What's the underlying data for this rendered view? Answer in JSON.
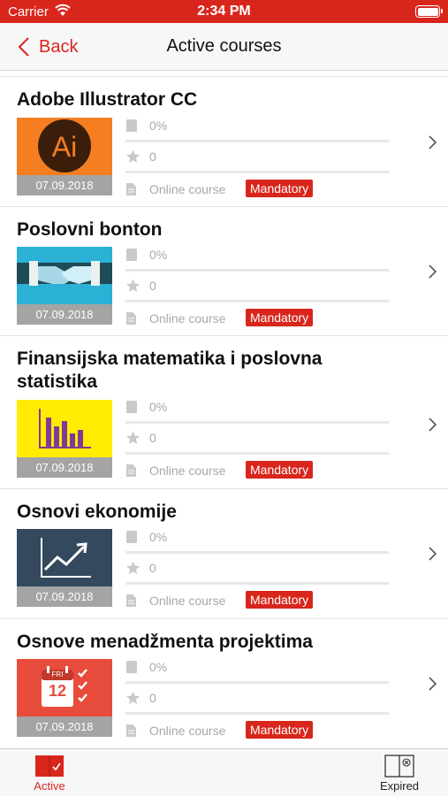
{
  "status_bar": {
    "carrier": "Carrier",
    "time": "2:34 PM"
  },
  "nav": {
    "back_label": "Back",
    "title": "Active courses"
  },
  "courses": [
    {
      "title": "Adobe Illustrator CC",
      "date": "07.09.2018",
      "progress": "0%",
      "rating": "0",
      "type": "Online course",
      "badge": "Mandatory",
      "thumb_icon": "illustrator-logo-icon",
      "thumb_color": "#f47e21"
    },
    {
      "title": "Poslovni bonton",
      "date": "07.09.2018",
      "progress": "0%",
      "rating": "0",
      "type": "Online course",
      "badge": "Mandatory",
      "thumb_icon": "handshake-icon",
      "thumb_color": "#2bb0d6"
    },
    {
      "title": "Finansijska matematika i poslovna statistika",
      "date": "07.09.2018",
      "progress": "0%",
      "rating": "0",
      "type": "Online course",
      "badge": "Mandatory",
      "thumb_icon": "bar-chart-icon",
      "thumb_color": "#ffec00"
    },
    {
      "title": "Osnovi ekonomije",
      "date": "07.09.2018",
      "progress": "0%",
      "rating": "0",
      "type": "Online course",
      "badge": "Mandatory",
      "thumb_icon": "trend-chart-icon",
      "thumb_color": "#34495e"
    },
    {
      "title": "Osnove menadžmenta projektima",
      "date": "07.09.2018",
      "progress": "0%",
      "rating": "0",
      "type": "Online course",
      "badge": "Mandatory",
      "thumb_icon": "calendar-checklist-icon",
      "thumb_color": "#e84c3d",
      "calendar_day": "FRI",
      "calendar_date": "12"
    }
  ],
  "tabs": {
    "active_label": "Active",
    "expired_label": "Expired"
  },
  "colors": {
    "accent": "#d9261c",
    "muted_text": "#a8a8a8",
    "date_strip": "#a4a4a4"
  }
}
